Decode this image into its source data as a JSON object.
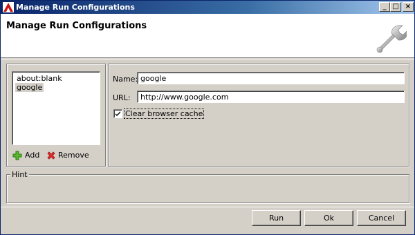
{
  "window": {
    "title": "Manage Run Configurations",
    "controls": {
      "minimize": "_",
      "maximize": "□",
      "close": "×"
    }
  },
  "header": {
    "title": "Manage Run Configurations",
    "icon": "wrench-icon"
  },
  "configurations": {
    "items": [
      {
        "label": "about:blank",
        "selected": false
      },
      {
        "label": "google",
        "selected": true
      }
    ],
    "add_label": "Add",
    "remove_label": "Remove",
    "add_icon": "plus-icon",
    "remove_icon": "red-x-icon"
  },
  "details": {
    "name_label": "Name:",
    "name_value": "google",
    "url_label": "URL:",
    "url_value": "http://www.google.com",
    "clear_cache_label": "Clear browser cache",
    "clear_cache_checked": true
  },
  "hint": {
    "label": "Hint"
  },
  "buttons": {
    "run": "Run",
    "ok": "Ok",
    "cancel": "Cancel"
  },
  "colors": {
    "face": "#d4d0c8",
    "title_start": "#0a246a",
    "title_end": "#a6caf0",
    "add_green": "#3c9a1c",
    "remove_red": "#d42020"
  }
}
